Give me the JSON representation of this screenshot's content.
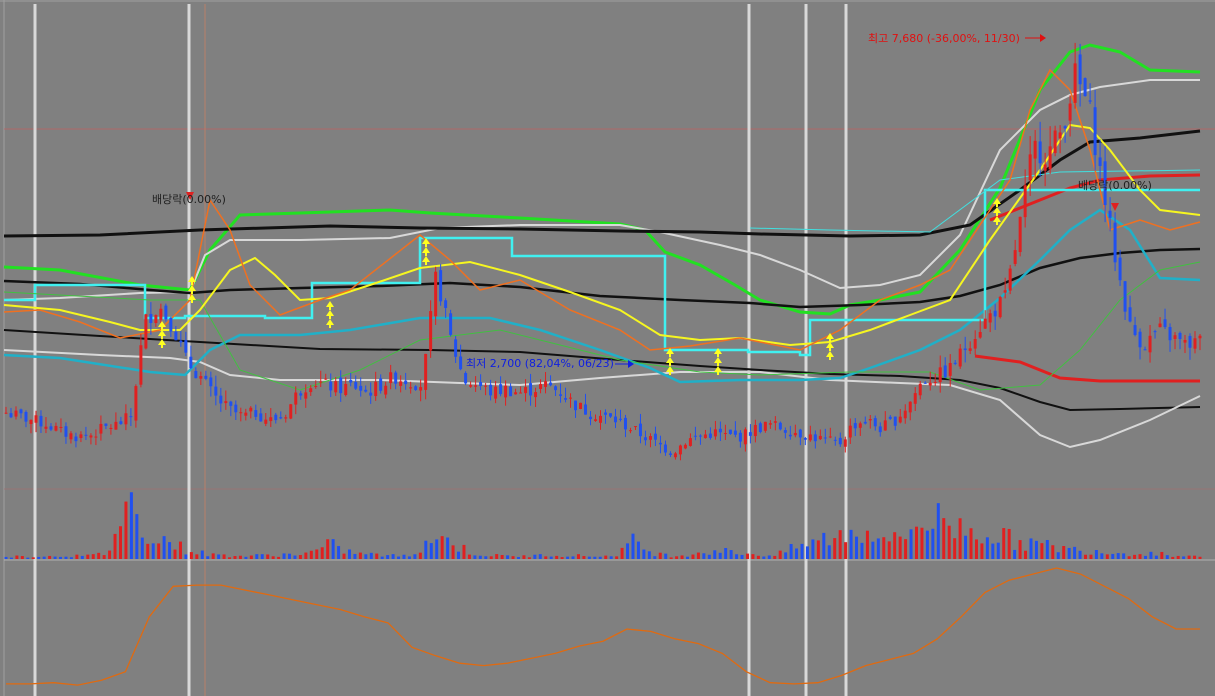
{
  "chart_data": {
    "type": "candlestick",
    "panels": [
      "price",
      "volume",
      "indicator"
    ],
    "grid": true,
    "price_axis": {
      "ylim": [
        2400,
        8400
      ],
      "log_scale": false
    },
    "annotations": {
      "high": {
        "text": "최고 7,680 (-36,00%, 11/30)",
        "value": 7680
      },
      "low": {
        "text": "최저 2,700 (82,04%, 06/23)",
        "value": 2700
      },
      "dividend_1": {
        "text": "배당락(0.00%)"
      },
      "dividend_2": {
        "text": "배당락(0.00%)"
      }
    },
    "candle_series_approx": {
      "note_values": [
        3250,
        3200,
        3150,
        3100,
        3000,
        2950,
        2960,
        3050,
        3100,
        3200,
        4400,
        4600,
        4350,
        3900,
        3700,
        3450,
        3300,
        3200,
        3250,
        3150,
        3200,
        3500,
        3650,
        3600,
        3550,
        3600,
        3500,
        3600,
        3700,
        3650,
        3600,
        5000,
        4200,
        3650,
        3600,
        3500,
        3550,
        3500,
        3550,
        3600,
        3500,
        3350,
        3250,
        3200,
        3150,
        3050,
        2950,
        2850,
        2750,
        2900,
        2950,
        3000,
        2950,
        2950,
        3050,
        3100,
        3050,
        3000,
        2950,
        2900,
        2850,
        3100,
        3150,
        3050,
        3150,
        3350,
        3650,
        3700,
        3800,
        4050,
        4300,
        4500,
        4700,
        5600,
        6600,
        6500,
        6800,
        7500,
        7100,
        6100,
        5100,
        4300,
        4100,
        4300,
        4200,
        4100,
        4150
      ]
    },
    "volume_relative": [
      0.05,
      0.04,
      0.05,
      0.06,
      0.05,
      0.1,
      1.0,
      0.5,
      0.3,
      0.15,
      0.08,
      0.06,
      0.05,
      0.07,
      0.08,
      0.1,
      0.25,
      0.12,
      0.08,
      0.06,
      0.05,
      0.4,
      0.3,
      0.1,
      0.06,
      0.05,
      0.05,
      0.08,
      0.06,
      0.05,
      0.05,
      0.3,
      0.1,
      0.05,
      0.1,
      0.15,
      0.12,
      0.08,
      0.06,
      0.2,
      0.3,
      0.4,
      0.45,
      0.5,
      0.3,
      0.6,
      0.7,
      0.55,
      0.5,
      0.4,
      0.3,
      0.25,
      0.2,
      0.15,
      0.15,
      0.1,
      0.1,
      0.1,
      0.05,
      0.06
    ],
    "indicator_line_approx": [
      0.05,
      0.05,
      0.06,
      0.04,
      0.08,
      0.15,
      0.6,
      0.85,
      0.86,
      0.86,
      0.82,
      0.78,
      0.74,
      0.7,
      0.66,
      0.6,
      0.55,
      0.35,
      0.28,
      0.22,
      0.2,
      0.22,
      0.26,
      0.3,
      0.36,
      0.4,
      0.5,
      0.48,
      0.42,
      0.38,
      0.3,
      0.15,
      0.06,
      0.05,
      0.06,
      0.12,
      0.2,
      0.25,
      0.3,
      0.42,
      0.6,
      0.8,
      0.9,
      0.95,
      1.0,
      0.95,
      0.85,
      0.75,
      0.6,
      0.5,
      0.5
    ]
  }
}
